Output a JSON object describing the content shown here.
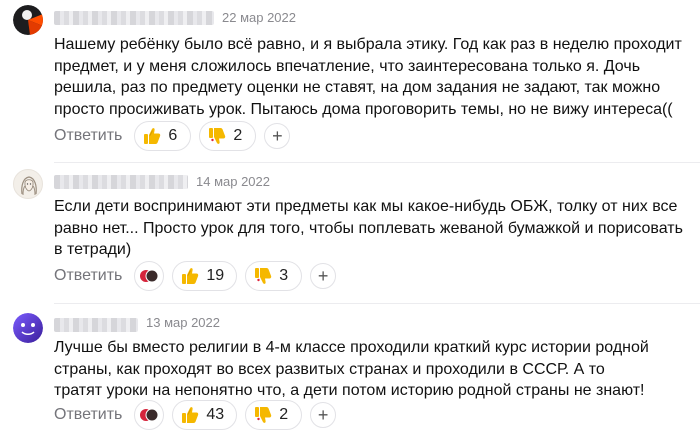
{
  "comments": [
    {
      "date": "22 мар 2022",
      "text": "Нашему ребёнку было всё равно, и я выбрала этику. Год как раз в неделю проходит предмет, и у меня сложилось впечатление, что заинтересована только я. Дочь решила, раз по предмету оценки не ставят, на дом задания не задают, так можно просто просиживать урок. Пытаюсь дома проговорить темы, но не вижу интереса((",
      "reply_label": "Ответить",
      "likes": "6",
      "dislikes": "2",
      "add_label": "+"
    },
    {
      "date": "14 мар 2022",
      "text": "Если дети воспринимают эти предметы как мы какое-нибудь ОБЖ, толку от них все равно нет... Просто урок для того, чтобы поплевать жеваной бумажкой и порисовать в тетради)",
      "reply_label": "Ответить",
      "likes": "19",
      "dislikes": "3",
      "add_label": "+"
    },
    {
      "date": "13 мар 2022",
      "text": "Лучше бы вместо религии в 4-м классе проходили краткий курс истории родной страны, как проходят во всех развитых странах и проходили в СССР. А то тратят уроки на непонятно что, а дети потом историю родной страны не знают!",
      "reply_label": "Ответить",
      "likes": "43",
      "dislikes": "2",
      "add_label": "+"
    }
  ],
  "icons": {
    "like": "thumbs-up-emoji-icon",
    "dislike": "thumbs-down-emoji-icon",
    "reactors": "reactor-avatars-icon",
    "add": "plus-icon"
  },
  "colors": {
    "reaction_yellow": "#f5b800",
    "muted_text": "#8a8a8f",
    "border": "#e2e2e6"
  }
}
